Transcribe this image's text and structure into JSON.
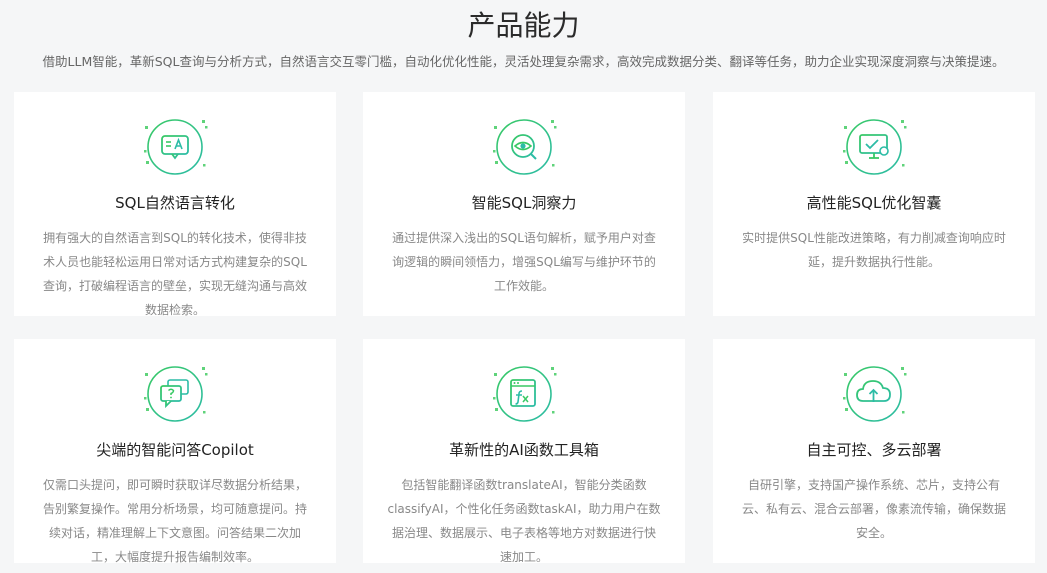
{
  "section": {
    "title": "产品能力",
    "subtitle": "借助LLM智能，革新SQL查询与分析方式，自然语言交互零门槛，自动化优化性能，灵活处理复杂需求，高效完成数据分类、翻译等任务，助力企业实现深度洞察与决策提速。"
  },
  "accent_colors": {
    "green": "#3ccf6e",
    "teal": "#2bbfa8",
    "dot": "#5fd37a"
  },
  "cards": [
    {
      "icon": "chat-translate-icon",
      "title": "SQL自然语言转化",
      "desc": "拥有强大的自然语言到SQL的转化技术，使得非技术人员也能轻松运用日常对话方式构建复杂的SQL查询，打破编程语言的壁垒，实现无缝沟通与高效数据检索。"
    },
    {
      "icon": "eye-insight-icon",
      "title": "智能SQL洞察力",
      "desc": "通过提供深入浅出的SQL语句解析，赋予用户对查询逻辑的瞬间领悟力，增强SQL编写与维护环节的工作效能。"
    },
    {
      "icon": "monitor-optimize-icon",
      "title": "高性能SQL优化智囊",
      "desc": "实时提供SQL性能改进策略，有力削减查询响应时延，提升数据执行性能。"
    },
    {
      "icon": "qa-chat-icon",
      "title": "尖端的智能问答Copilot",
      "desc": "仅需口头提问，即可瞬时获取详尽数据分析结果，告别繁复操作。常用分析场景，均可随意提问。持续对话，精准理解上下文意图。问答结果二次加工，大幅度提升报告编制效率。"
    },
    {
      "icon": "function-fx-icon",
      "title": "革新性的AI函数工具箱",
      "desc": "包括智能翻译函数translateAI，智能分类函数classifyAI，个性化任务函数taskAI，助力用户在数据治理、数据展示、电子表格等地方对数据进行快速加工。"
    },
    {
      "icon": "cloud-upload-icon",
      "title": "自主可控、多云部署",
      "desc": "自研引擎，支持国产操作系统、芯片，支持公有云、私有云、混合云部署，像素流传输，确保数据安全。"
    }
  ]
}
